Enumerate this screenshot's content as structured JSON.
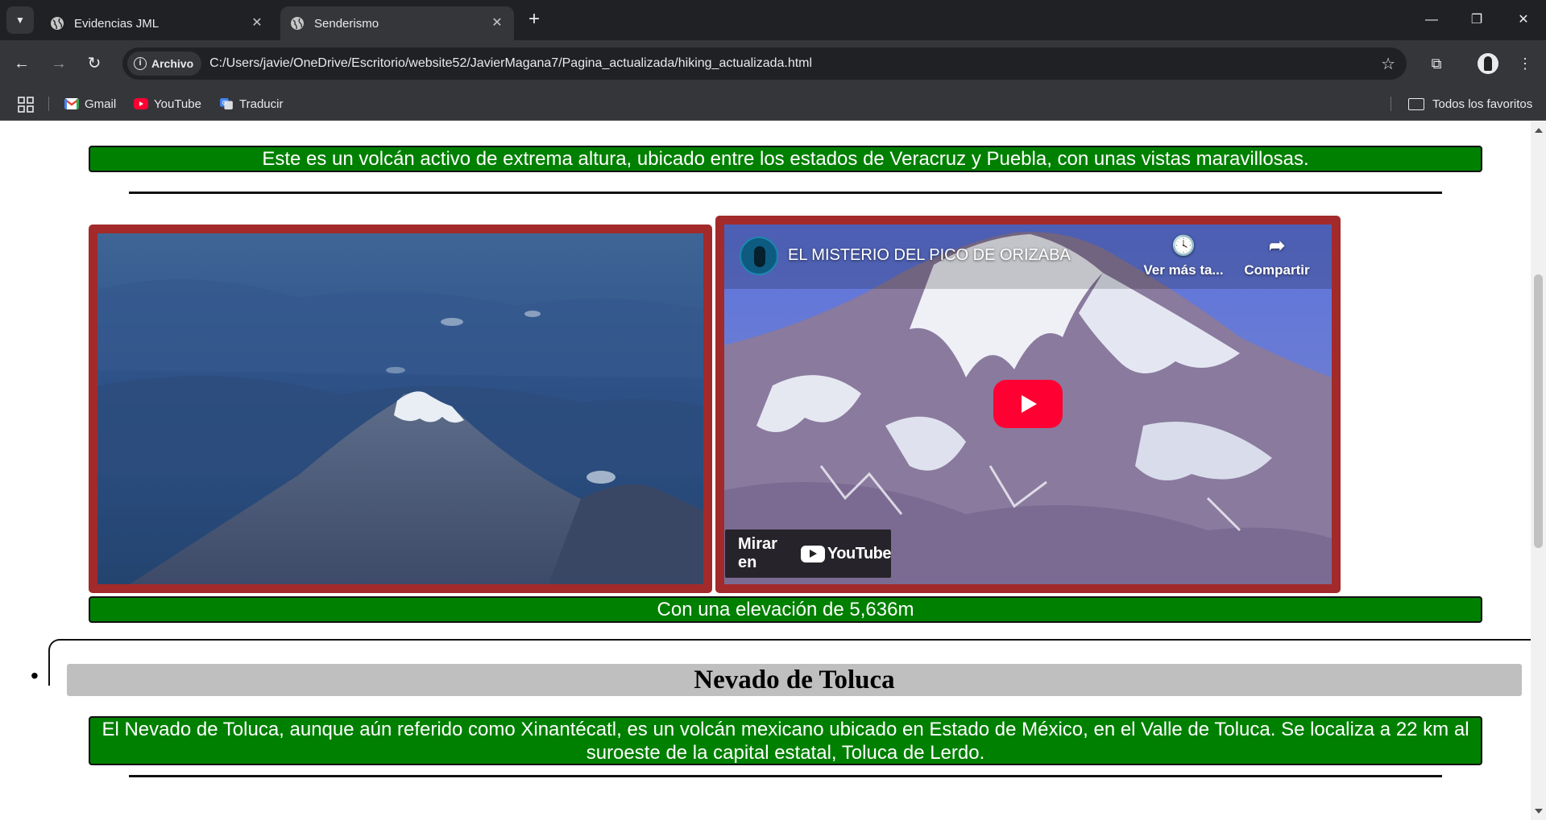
{
  "browser": {
    "tabs": [
      {
        "title": "Evidencias JML",
        "active": false
      },
      {
        "title": "Senderismo",
        "active": true
      }
    ],
    "address": {
      "chip_label": "Archivo",
      "url": "C:/Users/javie/OneDrive/Escritorio/website52/JavierMagana7/Pagina_actualizada/hiking_actualizada.html"
    },
    "bookmarks": [
      {
        "label": "Gmail"
      },
      {
        "label": "YouTube"
      },
      {
        "label": "Traducir"
      }
    ],
    "all_bookmarks_label": "Todos los favoritos"
  },
  "page": {
    "orizaba_description": "Este es un volcán activo de extrema altura, ubicado entre los estados de Veracruz y Puebla, con unas vistas maravillosas.",
    "video": {
      "title": "EL MISTERIO DEL PICO DE ORIZABA",
      "watch_later": "Ver más ta...",
      "share": "Compartir",
      "watch_on": "Mirar en",
      "platform": "YouTube"
    },
    "orizaba_elevation": "Con una elevación de 5,636m",
    "next_section_title": "Nevado de Toluca",
    "toluca_description": "El Nevado de Toluca, aunque aún referido como Xinantécatl, es un volcán mexicano ubicado en Estado de México, en el Valle de Toluca. Se localiza a 22 km al suroeste de la capital estatal, Toluca de Lerdo."
  },
  "colors": {
    "caption_green": "#008000",
    "frame_red": "#a22a2a",
    "heading_gray": "#bfbfbf",
    "yt_red": "#ff0033"
  }
}
